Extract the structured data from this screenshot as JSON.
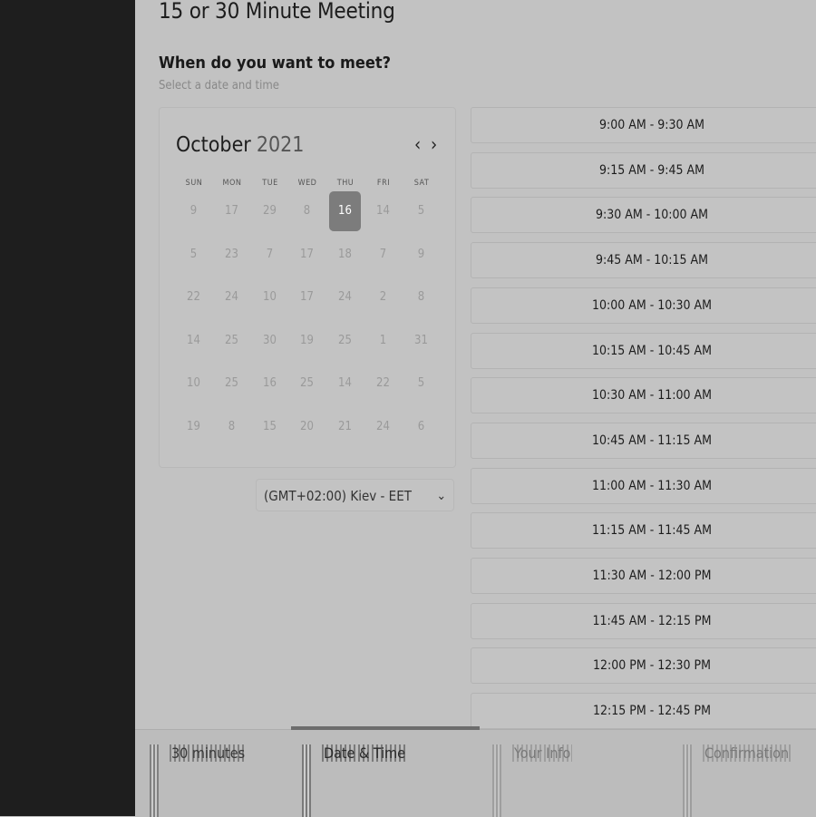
{
  "meeting": {
    "title": "15 or 30 Minute Meeting",
    "question": "When do you want to meet?",
    "hint": "Select a date and time"
  },
  "calendar": {
    "month": "October",
    "year": "2021",
    "prev_icon": "chevron-left-icon",
    "next_icon": "chevron-right-icon",
    "weekdays": [
      "SUN",
      "MON",
      "TUE",
      "WED",
      "THU",
      "FRI",
      "SAT"
    ],
    "selected_day": "16",
    "weeks": [
      [
        "9",
        "17",
        "29",
        "8",
        "16",
        "14",
        "5"
      ],
      [
        "5",
        "23",
        "7",
        "17",
        "18",
        "7",
        "9"
      ],
      [
        "22",
        "24",
        "10",
        "17",
        "24",
        "2",
        "8"
      ],
      [
        "14",
        "25",
        "30",
        "19",
        "25",
        "1",
        "31"
      ],
      [
        "10",
        "25",
        "16",
        "25",
        "14",
        "22",
        "5"
      ],
      [
        "19",
        "8",
        "15",
        "20",
        "21",
        "24",
        "6"
      ]
    ]
  },
  "timezone": {
    "value": "(GMT+02:00) Kiev - EET",
    "icon": "chevron-down-icon"
  },
  "time_slots": [
    "9:00 AM - 9:30 AM",
    "9:15 AM - 9:45 AM",
    "9:30 AM - 10:00 AM",
    "9:45 AM - 10:15 AM",
    "10:00 AM - 10:30 AM",
    "10:15 AM - 10:45 AM",
    "10:30 AM - 11:00 AM",
    "10:45 AM - 11:15 AM",
    "11:00 AM - 11:30 AM",
    "11:15 AM - 11:45 AM",
    "11:30 AM - 12:00 PM",
    "11:45 AM - 12:15 PM",
    "12:00 PM - 12:30 PM",
    "12:15 PM - 12:45 PM"
  ],
  "steps": [
    {
      "label": "30 minutes",
      "icon": "clock-icon",
      "active": false
    },
    {
      "label": "Date & Time",
      "icon": "calendar-icon",
      "active": true
    },
    {
      "label": "Your Info",
      "icon": "user-icon",
      "active": false
    },
    {
      "label": "Confirmation",
      "icon": "check-icon",
      "active": false
    }
  ],
  "colors": {
    "sidebar": "#1e1e1e",
    "overlay_bg": "#c2c2c2",
    "selected_day": "#7c7c7c",
    "active_step_bar": "#6c6c6c"
  }
}
